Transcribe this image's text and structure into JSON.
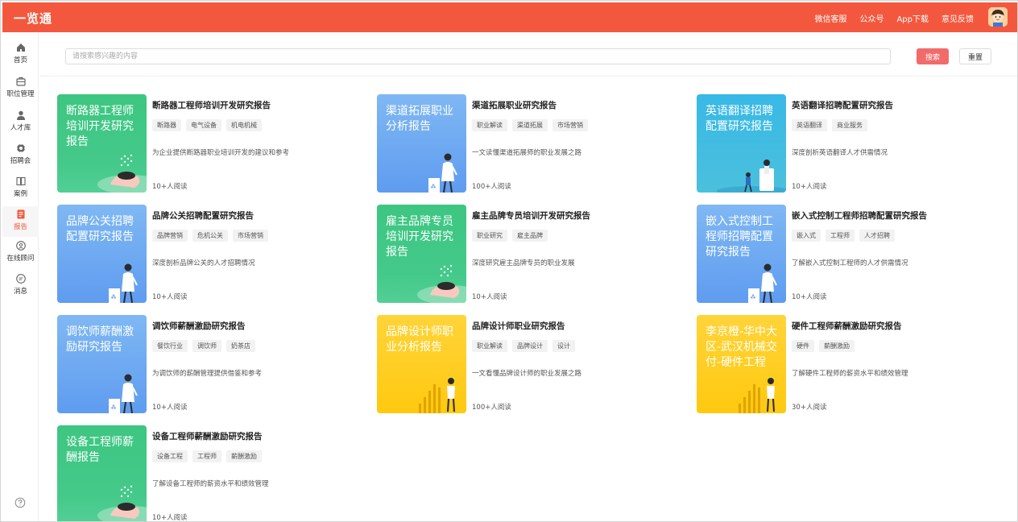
{
  "header": {
    "brand": "一览通",
    "nav": [
      "微信客服",
      "公众号",
      "App下载",
      "意见反馈"
    ]
  },
  "sidebar": {
    "items": [
      {
        "label": "首页",
        "icon": "home-icon"
      },
      {
        "label": "职位管理",
        "icon": "briefcase-icon"
      },
      {
        "label": "人才库",
        "icon": "person-icon"
      },
      {
        "label": "招聘会",
        "icon": "gear-icon"
      },
      {
        "label": "案例",
        "icon": "book-icon"
      },
      {
        "label": "报告",
        "icon": "report-icon",
        "active": true
      },
      {
        "label": "在线顾问",
        "icon": "advisor-icon"
      },
      {
        "label": "消息",
        "icon": "message-icon"
      }
    ]
  },
  "search": {
    "placeholder": "请搜索感兴趣的内容",
    "search_label": "搜索",
    "reset_label": "重置"
  },
  "colors": {
    "accent": "#f3583e",
    "search_button": "#f26b6b",
    "green": "#3dc681",
    "blue": "#6aa8f2",
    "cyan": "#3fbbe2",
    "yellow": "#ffcc1f"
  },
  "cards": [
    {
      "thumb_text": "断路器工程师培训开发研究报告",
      "title": "断路器工程师培训开发研究报告",
      "tags": [
        "断路器",
        "电气设备",
        "机电机械"
      ],
      "desc": "为企业提供断路器职业培训开发的建议和参考",
      "reads": "10+人阅读",
      "theme": "green"
    },
    {
      "thumb_text": "渠道拓展职业分析报告",
      "title": "渠道拓展职业研究报告",
      "tags": [
        "职业解读",
        "渠道拓展",
        "市场营销"
      ],
      "desc": "一文读懂渠道拓展师的职业发展之路",
      "reads": "100+人阅读",
      "theme": "blue"
    },
    {
      "thumb_text": "英语翻译招聘配置研究报告",
      "title": "英语翻译招聘配置研究报告",
      "tags": [
        "英语翻译",
        "商业服务"
      ],
      "desc": "深度剖析英语翻译人才供需情况",
      "reads": "10+人阅读",
      "theme": "cyan"
    },
    {
      "thumb_text": "品牌公关招聘配置研究报告",
      "title": "品牌公关招聘配置研究报告",
      "tags": [
        "品牌营销",
        "危机公关",
        "市场营销"
      ],
      "desc": "深度剖析品牌公关的人才招聘情况",
      "reads": "10+人阅读",
      "theme": "blue"
    },
    {
      "thumb_text": "雇主品牌专员培训开发研究报告",
      "title": "雇主品牌专员培训开发研究报告",
      "tags": [
        "职业研究",
        "雇主品牌"
      ],
      "desc": "深度研究雇主品牌专员的职业发展",
      "reads": "10+人阅读",
      "theme": "green"
    },
    {
      "thumb_text": "嵌入式控制工程师招聘配置研究报告",
      "title": "嵌入式控制工程师招聘配置研究报告",
      "tags": [
        "嵌入式",
        "工程师",
        "人才招聘"
      ],
      "desc": "了解嵌入式控制工程师的人才供需情况",
      "reads": "10+人阅读",
      "theme": "blue"
    },
    {
      "thumb_text": "调饮师薪酬激励研究报告",
      "title": "调饮师薪酬激励研究报告",
      "tags": [
        "餐饮行业",
        "调饮师",
        "奶茶店"
      ],
      "desc": "为调饮师的薪酬管理提供借鉴和参考",
      "reads": "10+人阅读",
      "theme": "blue"
    },
    {
      "thumb_text": "品牌设计师职业分析报告",
      "title": "品牌设计师职业研究报告",
      "tags": [
        "职业解读",
        "品牌设计",
        "设计"
      ],
      "desc": "一文看懂品牌设计师的职业发展之路",
      "reads": "100+人阅读",
      "theme": "yellow"
    },
    {
      "thumb_text": "李京橙-华中大区-武汉机械交付-硬件工程",
      "title": "硬件工程师薪酬激励研究报告",
      "tags": [
        "硬件",
        "薪酬激励"
      ],
      "desc": "了解硬件工程师的薪资水平和绩效管理",
      "reads": "30+人阅读",
      "theme": "yellow"
    },
    {
      "thumb_text": "设备工程师薪酬报告",
      "title": "设备工程师薪酬激励研究报告",
      "tags": [
        "设备工程",
        "工程师",
        "薪酬激励"
      ],
      "desc": "了解设备工程师的薪资水平和绩效管理",
      "reads": "10+人阅读",
      "theme": "green"
    }
  ]
}
